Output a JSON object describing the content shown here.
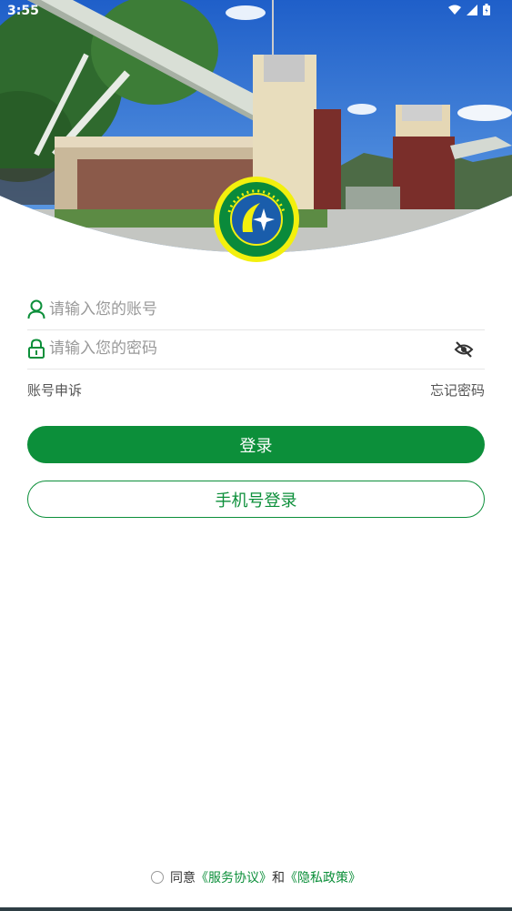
{
  "status": {
    "time": "3:55"
  },
  "login": {
    "username_placeholder": "请输入您的账号",
    "password_placeholder": "请输入您的密码",
    "appeal_link": "账号申诉",
    "forgot_link": "忘记密码",
    "login_button": "登录",
    "phone_login_button": "手机号登录"
  },
  "agreement": {
    "prefix": "同意",
    "service_link": "《服务协议》",
    "connector": "和",
    "privacy_link": "《隐私政策》"
  },
  "colors": {
    "brand": "#0c8f3a",
    "placeholder": "#999999",
    "divider": "#e6e6e6"
  },
  "icons": {
    "username": "user-icon",
    "password": "lock-icon",
    "visibility": "eye-off-icon",
    "logo": "school-logo"
  }
}
